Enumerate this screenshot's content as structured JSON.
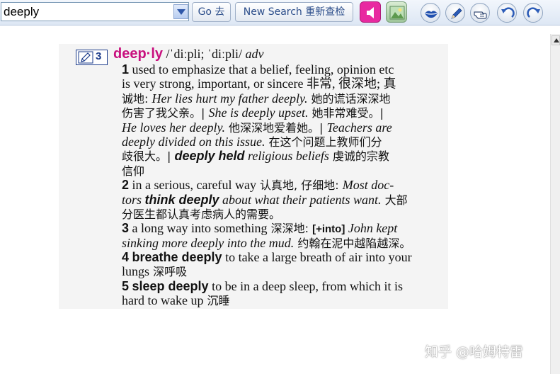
{
  "toolbar": {
    "search_value": "deeply",
    "go_label": "Go 去",
    "new_search_label": "New Search 重新查检",
    "icons": [
      "dropdown-arrow-icon",
      "speaker-icon",
      "picture-icon",
      "lips-icon",
      "pencil-icon",
      "pointing-hand-icon",
      "undo-icon",
      "redo-icon"
    ],
    "colors": {
      "sound": "#e82aa0",
      "button_text": "#2b4d8a"
    }
  },
  "entry": {
    "frequency": "3",
    "headword": "deep·ly",
    "pronunciation": "/ˈdiːpli; ˈdiːpli/",
    "pos": "adv",
    "sense1": {
      "num": "1",
      "l1": "used to emphasize that a belief, feeling, opinion etc",
      "l2": "is very strong, important, or sincere 非常, 很深地; 真",
      "l3a": "诚地: ",
      "l3b": "Her lies hurt my father deeply.",
      "l3c": " 她的谎话深深地",
      "l4a": "伤害了我父亲。| ",
      "l4b": "She is deeply upset.",
      "l4c": " 她非常难受。|",
      "l5a": "He loves her deeply.",
      "l5b": " 他深深地爱着她。| ",
      "l5c": "Teachers are",
      "l6a": "deeply divided on this issue.",
      "l6b": " 在这个问题上教师们分",
      "l7a": "歧很大。| ",
      "l7b": "deeply held",
      "l7c": " religious beliefs",
      "l7d": " 虔诚的宗教",
      "l8": "信仰"
    },
    "sense2": {
      "num": "2",
      "l1a": "in a serious, careful way",
      "l1b": " 认真地, 仔细地: ",
      "l1c": "Most doc-",
      "l2a": "tors ",
      "l2b": "think deeply",
      "l2c": " about what their patients want.",
      "l2d": " 大部",
      "l3": "分医生都认真考虑病人的需要。"
    },
    "sense3": {
      "num": "3",
      "l1a": "a long way into something",
      "l1b": " 深深地: ",
      "l1c": "[+into]",
      "l1d": " John kept",
      "l2a": "sinking more deeply into the mud.",
      "l2b": " 约翰在泥中越陷越深。"
    },
    "sense4": {
      "num": "4",
      "phrase": "breathe deeply",
      "l1": " to take a large breath of air into your",
      "l2a": "lungs",
      "l2b": " 深呼吸"
    },
    "sense5": {
      "num": "5",
      "phrase": "sleep deeply",
      "l1": " to be in a deep sleep, from which it is",
      "l2a": "hard to wake up",
      "l2b": " 沉睡"
    }
  },
  "watermark": "知乎 @哈姆特雷"
}
